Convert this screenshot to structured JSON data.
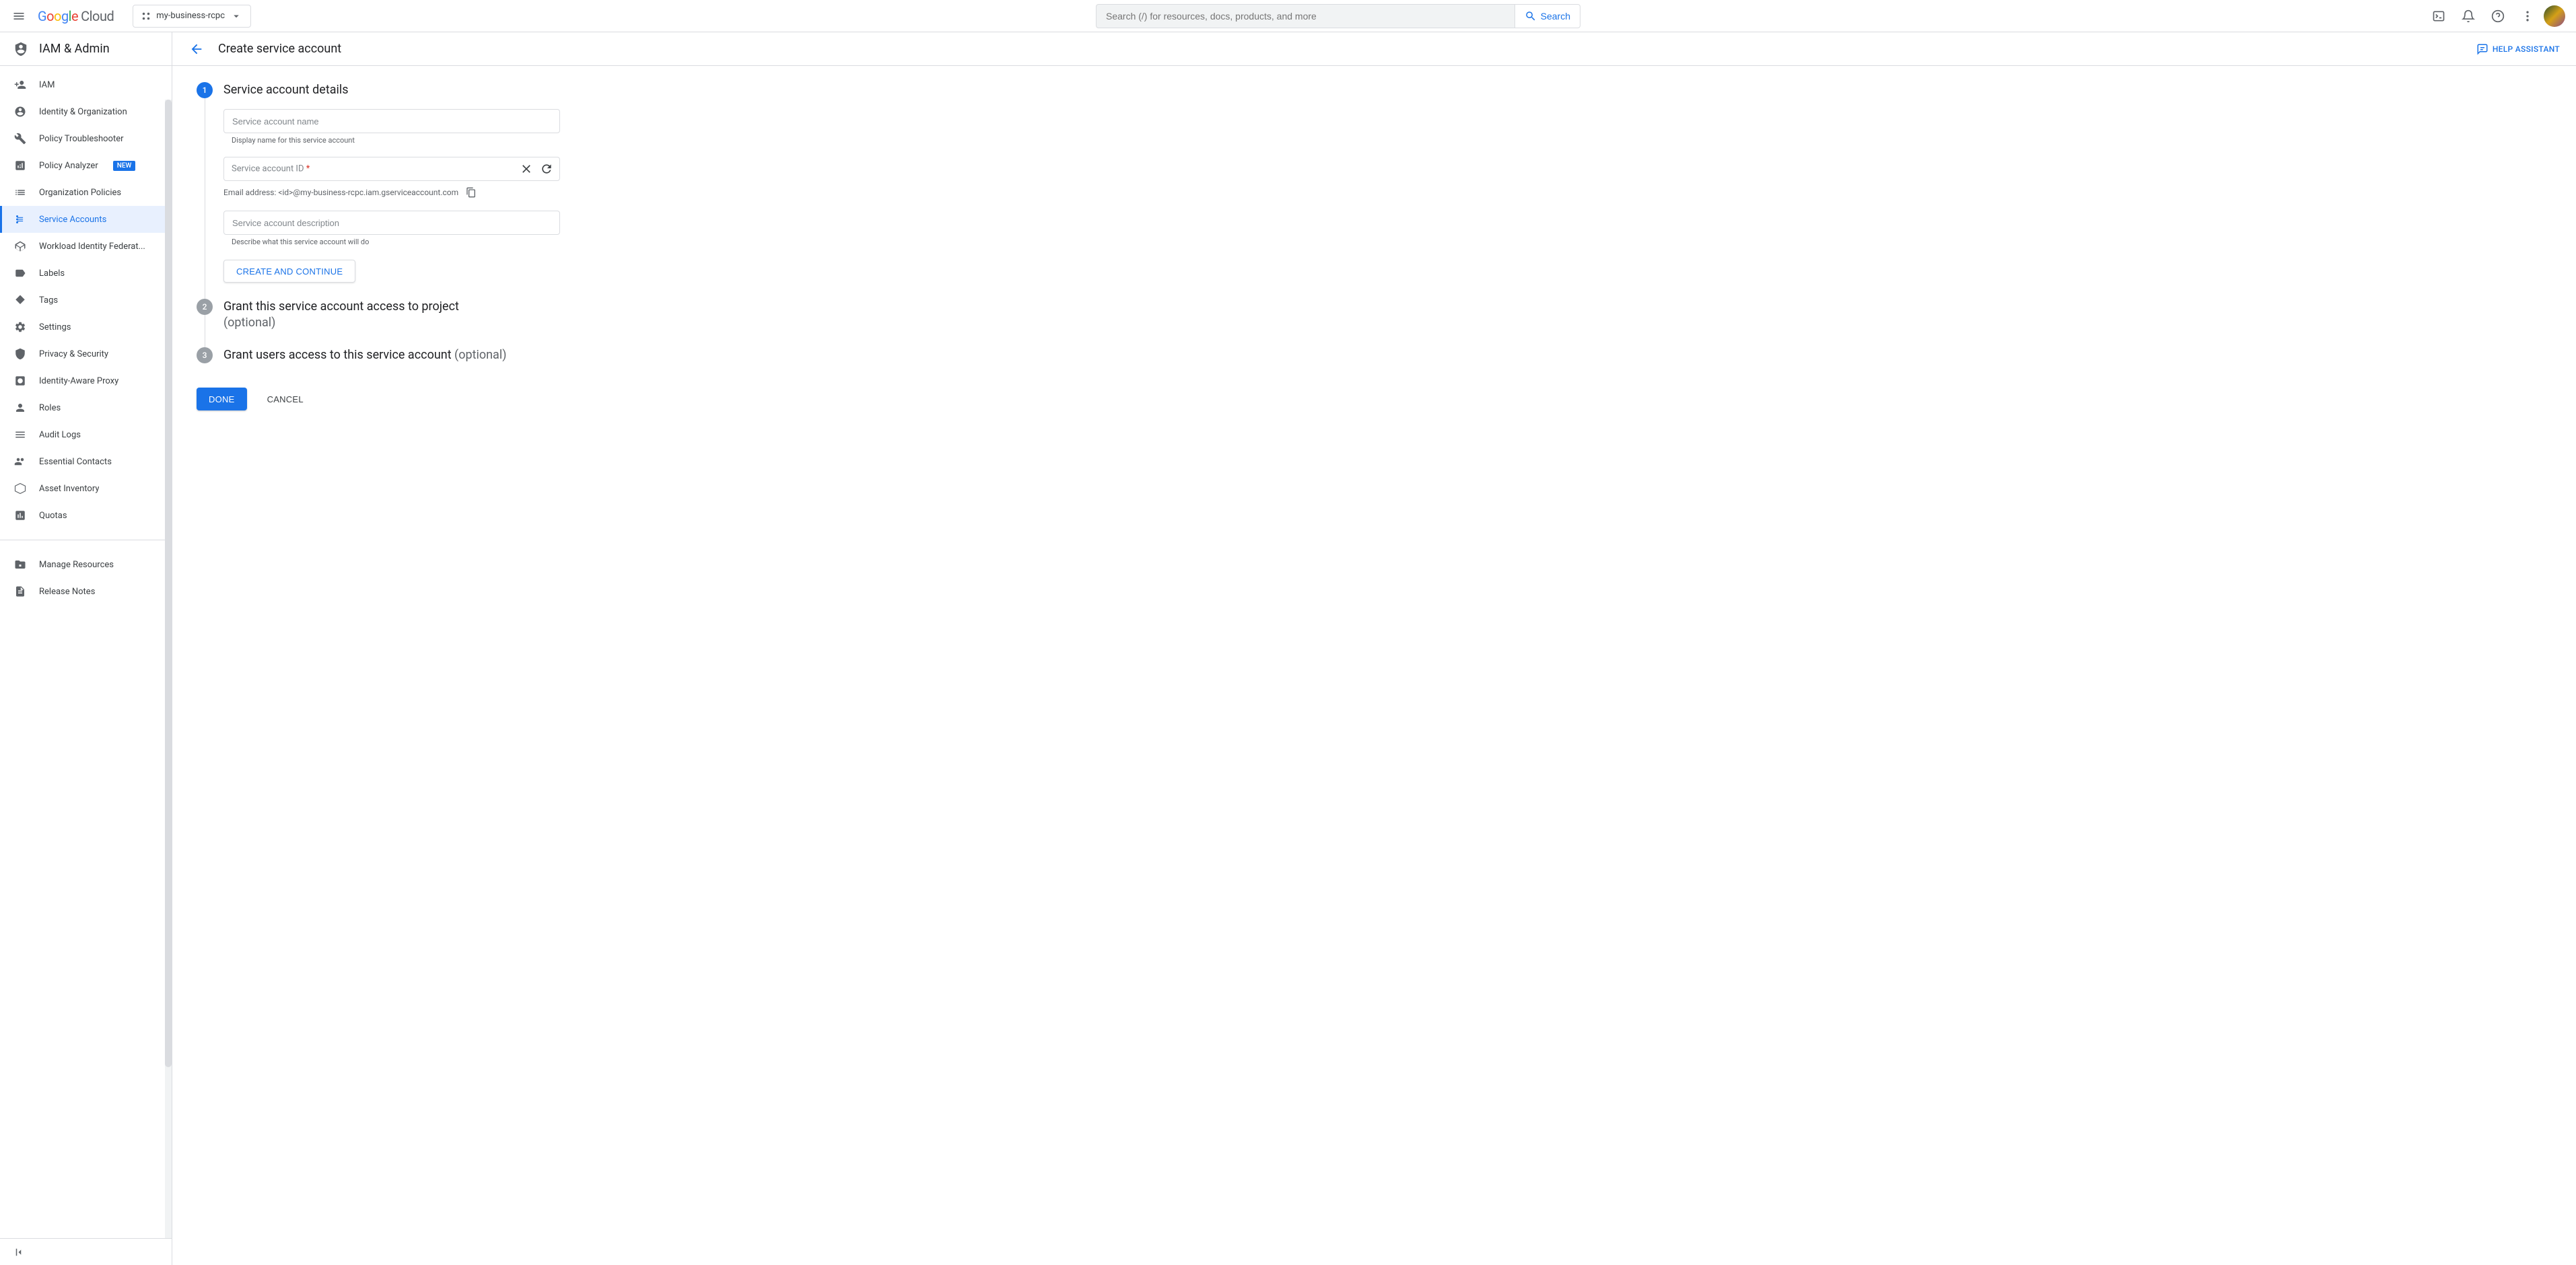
{
  "header": {
    "logo_cloud": "Cloud",
    "project_name": "my-business-rcpc",
    "search_placeholder": "Search (/) for resources, docs, products, and more",
    "search_button": "Search"
  },
  "sidebar": {
    "title": "IAM & Admin",
    "items": [
      {
        "label": "IAM",
        "icon": "person-add"
      },
      {
        "label": "Identity & Organization",
        "icon": "person-circle"
      },
      {
        "label": "Policy Troubleshooter",
        "icon": "wrench"
      },
      {
        "label": "Policy Analyzer",
        "icon": "analyzer",
        "badge": "NEW"
      },
      {
        "label": "Organization Policies",
        "icon": "list"
      },
      {
        "label": "Service Accounts",
        "icon": "service-account",
        "active": true
      },
      {
        "label": "Workload Identity Federat...",
        "icon": "workload"
      },
      {
        "label": "Labels",
        "icon": "label"
      },
      {
        "label": "Tags",
        "icon": "tag"
      },
      {
        "label": "Settings",
        "icon": "gear"
      },
      {
        "label": "Privacy & Security",
        "icon": "shield"
      },
      {
        "label": "Identity-Aware Proxy",
        "icon": "proxy"
      },
      {
        "label": "Roles",
        "icon": "roles"
      },
      {
        "label": "Audit Logs",
        "icon": "audit"
      },
      {
        "label": "Essential Contacts",
        "icon": "contacts"
      },
      {
        "label": "Asset Inventory",
        "icon": "asset"
      },
      {
        "label": "Quotas",
        "icon": "quota"
      }
    ],
    "footer_items": [
      {
        "label": "Manage Resources",
        "icon": "manage"
      },
      {
        "label": "Release Notes",
        "icon": "notes"
      }
    ]
  },
  "page": {
    "title": "Create service account",
    "help_assistant": "HELP ASSISTANT"
  },
  "step1": {
    "title": "Service account details",
    "name_placeholder": "Service account name",
    "name_helper": "Display name for this service account",
    "id_placeholder": "Service account ID",
    "email_prefix": "Email address: ",
    "email_value": "<id>@my-business-rcpc.iam.gserviceaccount.com",
    "desc_placeholder": "Service account description",
    "desc_helper": "Describe what this service account will do",
    "create_continue": "CREATE AND CONTINUE"
  },
  "step2": {
    "title": "Grant this service account access to project",
    "optional": "(optional)"
  },
  "step3": {
    "title": "Grant users access to this service account ",
    "optional": "(optional)"
  },
  "buttons": {
    "done": "DONE",
    "cancel": "CANCEL"
  }
}
